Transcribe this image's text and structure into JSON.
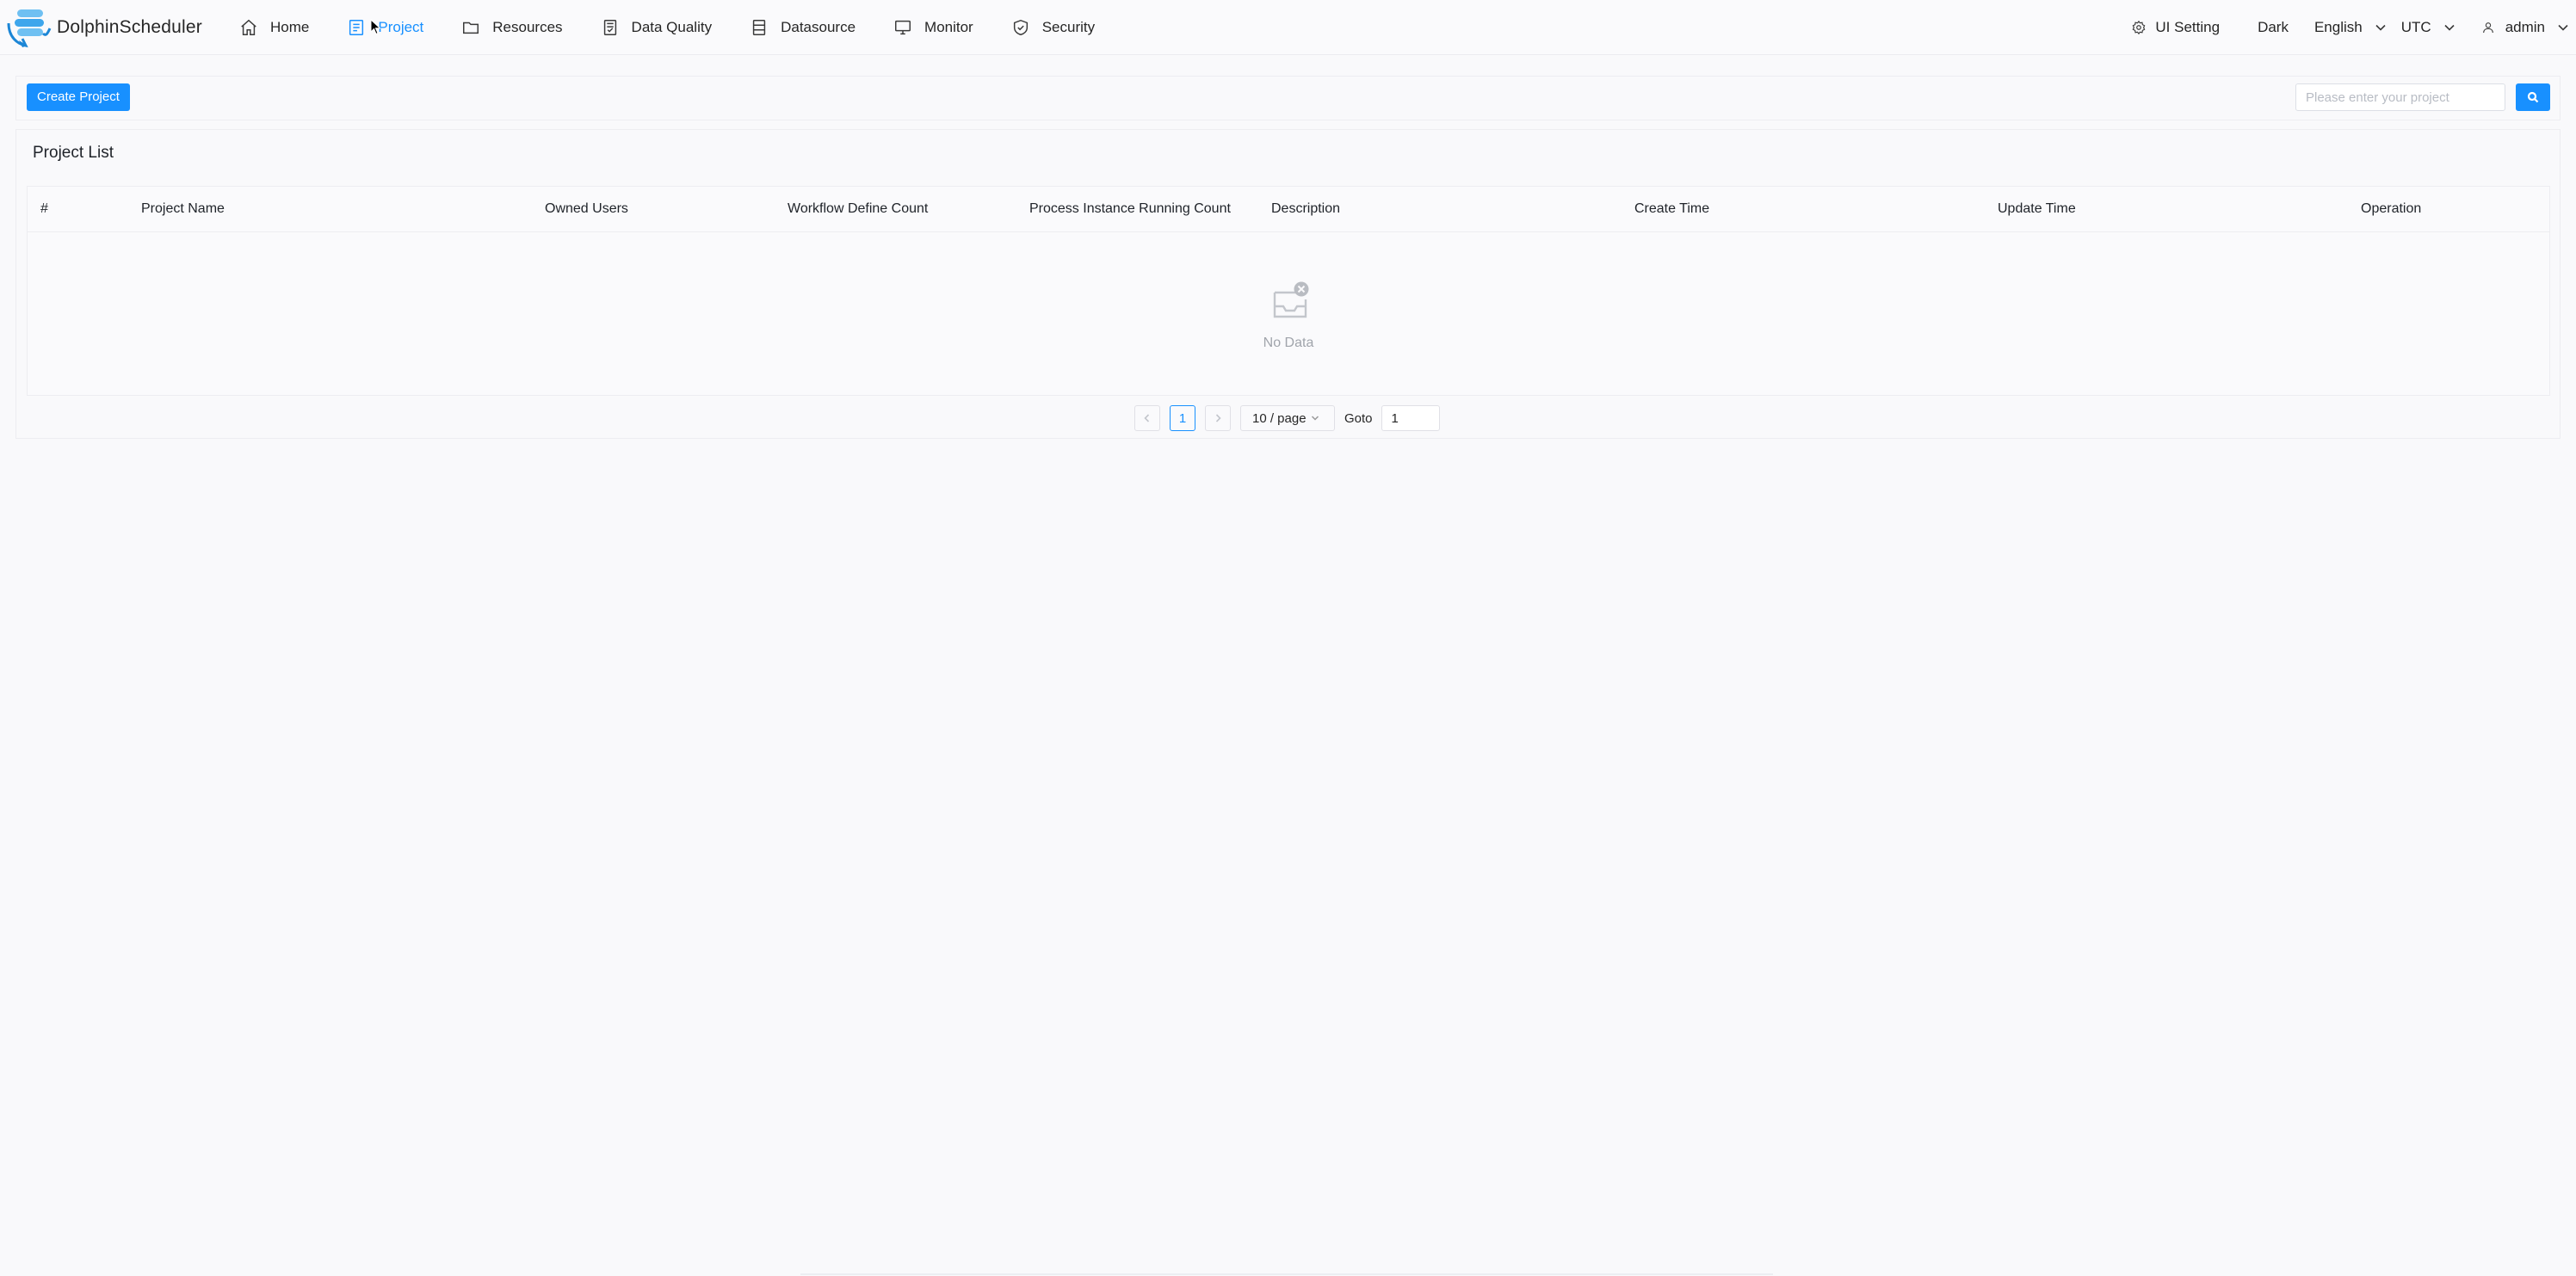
{
  "app": {
    "name": "DolphinScheduler"
  },
  "nav": {
    "items": [
      {
        "label": "Home",
        "icon": "home-icon",
        "active": false
      },
      {
        "label": "Project",
        "icon": "project-icon",
        "active": true
      },
      {
        "label": "Resources",
        "icon": "folder-icon",
        "active": false
      },
      {
        "label": "Data Quality",
        "icon": "data-quality-icon",
        "active": false
      },
      {
        "label": "Datasource",
        "icon": "datasource-icon",
        "active": false
      },
      {
        "label": "Monitor",
        "icon": "monitor-icon",
        "active": false
      },
      {
        "label": "Security",
        "icon": "shield-icon",
        "active": false
      }
    ]
  },
  "header_tools": {
    "ui_setting": "UI Setting",
    "theme": "Dark",
    "language": "English",
    "timezone": "UTC",
    "user": "admin"
  },
  "toolbar": {
    "create_label": "Create Project",
    "search_placeholder": "Please enter your project"
  },
  "list": {
    "title": "Project List",
    "columns": [
      "#",
      "Project Name",
      "Owned Users",
      "Workflow Define Count",
      "Process Instance Running Count",
      "Description",
      "Create Time",
      "Update Time",
      "Operation"
    ],
    "rows": [],
    "empty_text": "No Data"
  },
  "pagination": {
    "current_page": "1",
    "page_size": "10 / page",
    "goto_label": "Goto",
    "goto_value": "1"
  },
  "colors": {
    "accent": "#1890ff",
    "background": "#f9f9fb"
  }
}
